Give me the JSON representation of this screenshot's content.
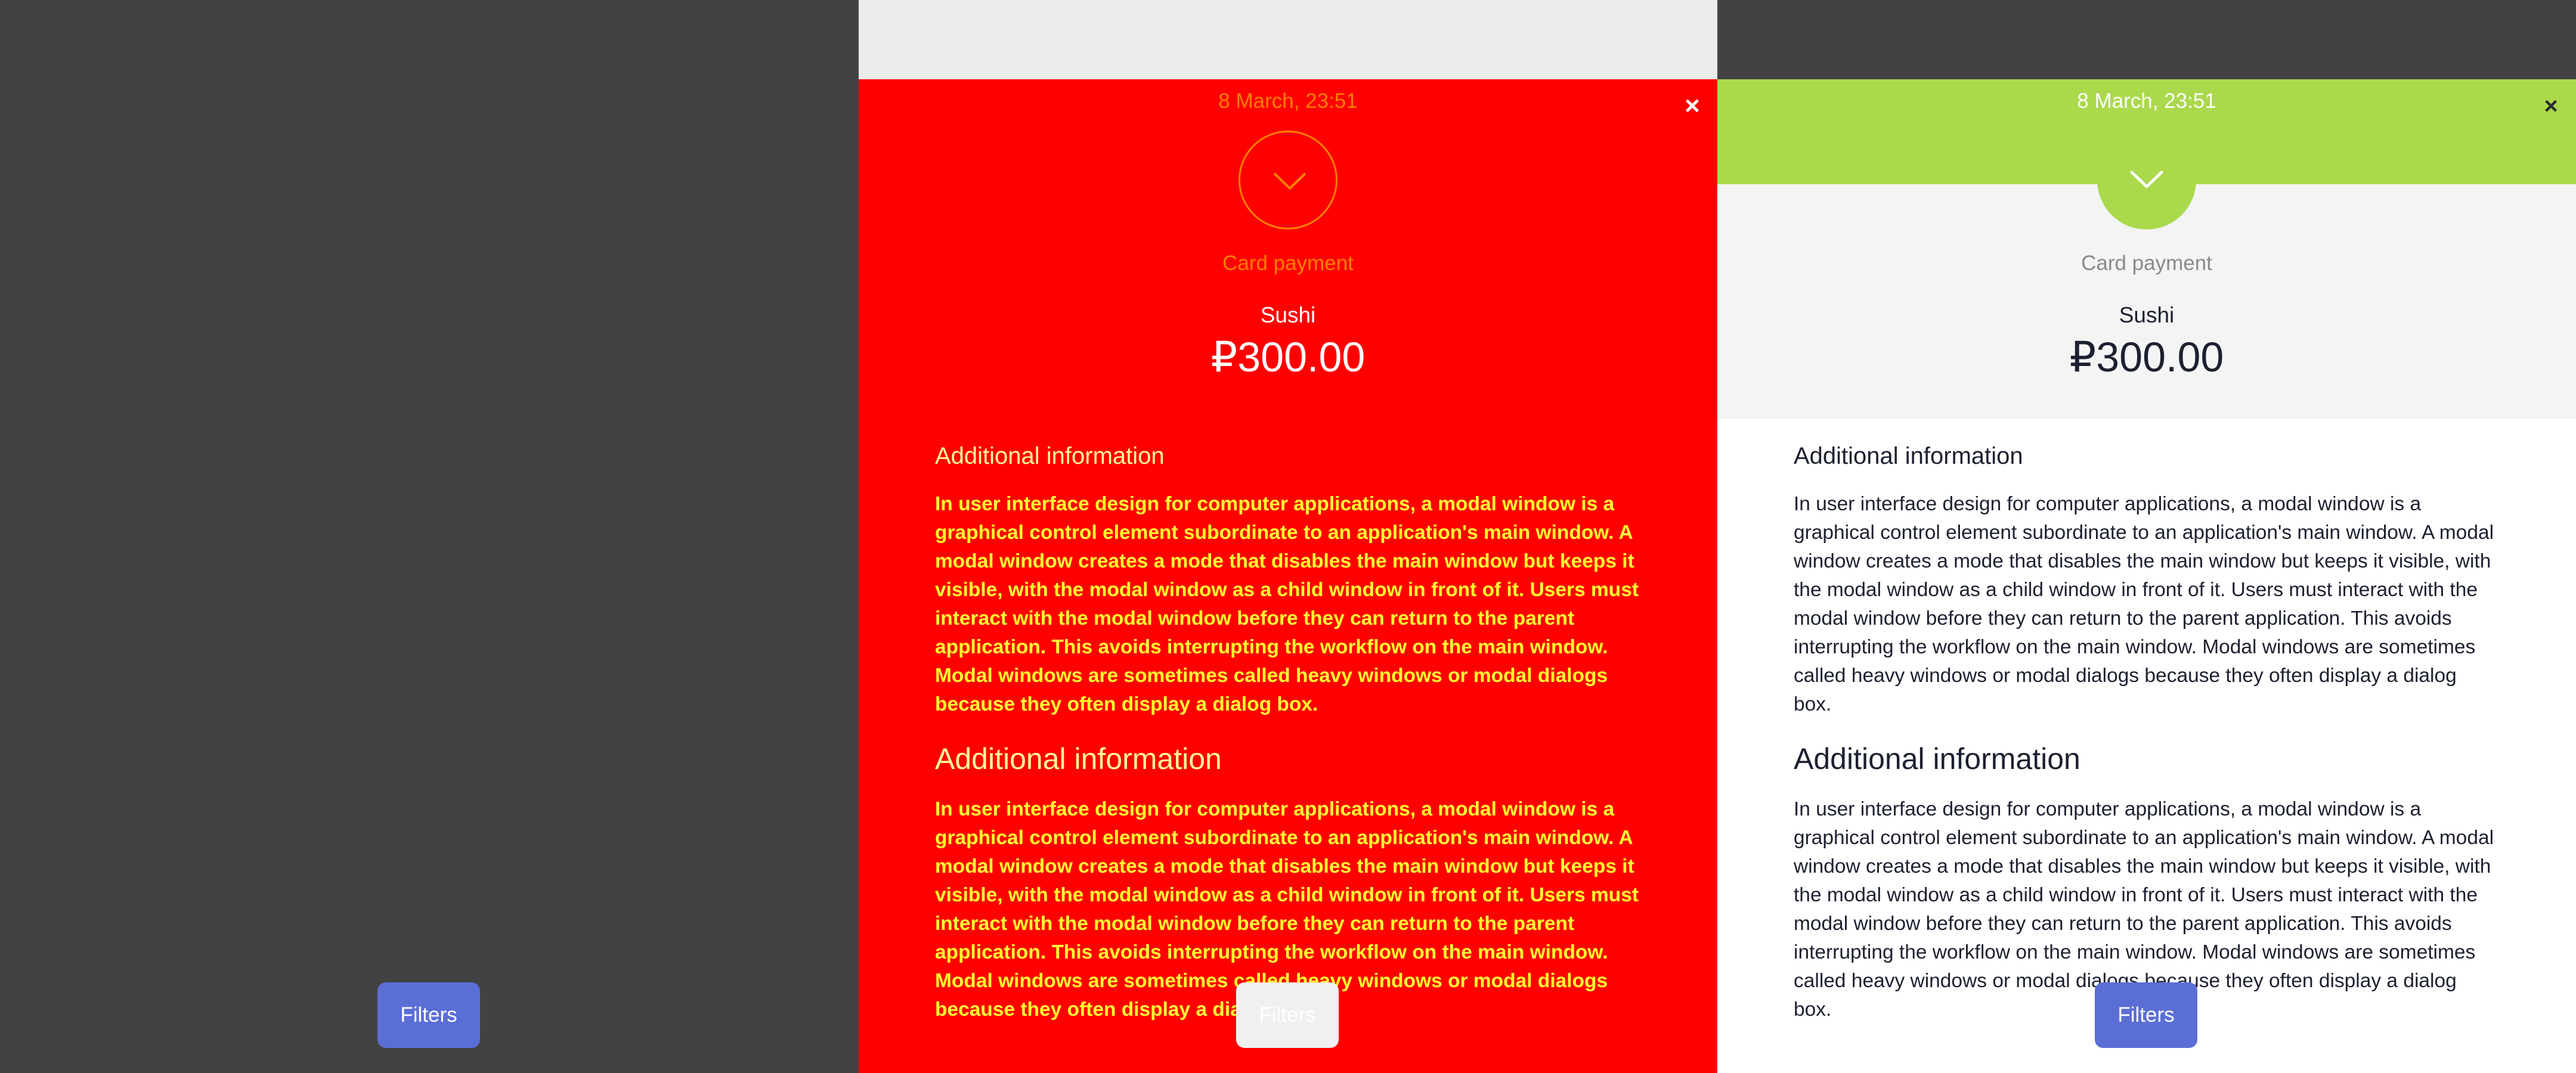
{
  "colors": {
    "backdrop": "#424242",
    "red_modal_bg": "#ff0000",
    "red_modal_accent": "#ff8000",
    "red_modal_text": "#ffff33",
    "light_modal_header": "#aad94c",
    "light_modal_bg": "#ffffff",
    "filters_button": "#5b6ed6"
  },
  "icons": {
    "close": "×",
    "status": "chevron-down-icon"
  },
  "panels": {
    "left": {
      "filters_label": "Filters"
    },
    "middle": {
      "date": "8 March, 23:51",
      "payment_type": "Card payment",
      "merchant": "Sushi",
      "amount": "₽300.00",
      "section_title_small": "Additional information",
      "section_body_1": "In user interface design for computer applications, a modal window is a graphical control element subordinate to an application's main window. A modal window creates a mode that disables the main window but keeps it visible, with the modal window as a child window in front of it. Users must interact with the modal window before they can return to the parent application. This avoids interrupting the workflow on the main window. Modal windows are sometimes called heavy windows or modal dialogs because they often display a dialog box.",
      "section_title_large": "Additional information",
      "section_body_2": "In user interface design for computer applications, a modal window is a graphical control element subordinate to an application's main window. A modal window creates a mode that disables the main window but keeps it visible, with the modal window as a child window in front of it. Users must interact with the modal window before they can return to the parent application. This avoids interrupting the workflow on the main window. Modal windows are sometimes called heavy windows or modal dialogs because they often display a dialog box.",
      "filters_label": "Filters"
    },
    "right": {
      "date": "8 March, 23:51",
      "payment_type": "Card payment",
      "merchant": "Sushi",
      "amount": "₽300.00",
      "section_title_small": "Additional information",
      "section_body_1": "In user interface design for computer applications, a modal window is a graphical control element subordinate to an application's main window. A modal window creates a mode that disables the main window but keeps it visible, with the modal window as a child window in front of it. Users must interact with the modal window before they can return to the parent application. This avoids interrupting the workflow on the main window. Modal windows are sometimes called heavy windows or modal dialogs because they often display a dialog box.",
      "section_title_large": "Additional information",
      "section_body_2": "In user interface design for computer applications, a modal window is a graphical control element subordinate to an application's main window. A modal window creates a mode that disables the main window but keeps it visible, with the modal window as a child window in front of it. Users must interact with the modal window before they can return to the parent application. This avoids interrupting the workflow on the main window. Modal windows are sometimes called heavy windows or modal dialogs because they often display a dialog box.",
      "filters_label": "Filters"
    }
  }
}
